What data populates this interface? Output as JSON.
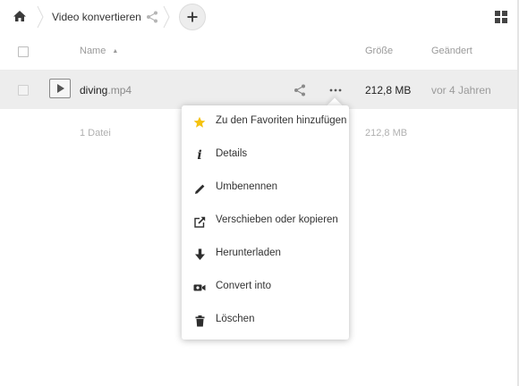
{
  "breadcrumb": {
    "home_icon": "home-icon",
    "current_folder": "Video konvertieren",
    "share_icon": "share-icon",
    "add_icon": "plus-icon",
    "add_label": "+"
  },
  "view_toggle_icon": "grid-view-icon",
  "table": {
    "headers": {
      "name": "Name",
      "size": "Größe",
      "modified": "Geändert"
    },
    "sort": {
      "column": "name",
      "direction": "ascending"
    }
  },
  "file": {
    "base": "diving",
    "ext": ".mp4",
    "type_icon": "video-file-icon",
    "size": "212,8 MB",
    "modified": "vor 4 Jahren"
  },
  "summary": {
    "count": "1 Datei",
    "size": "212,8 MB"
  },
  "menu": {
    "items": [
      {
        "label": "Zu den Favoriten hinzufügen",
        "icon": "star-icon"
      },
      {
        "label": "Details",
        "icon": "info-icon",
        "glyph": "i"
      },
      {
        "label": "Umbenennen",
        "icon": "pencil-icon"
      },
      {
        "label": "Verschieben oder kopieren",
        "icon": "external-move-icon"
      },
      {
        "label": "Herunterladen",
        "icon": "download-icon"
      },
      {
        "label": "Convert into",
        "icon": "video-camera-icon"
      },
      {
        "label": "Löschen",
        "icon": "trash-icon"
      }
    ]
  },
  "colors": {
    "star": "#f5c20f",
    "icon": "#2e2e2e",
    "row_highlight": "#ededed",
    "muted_text": "#9a9a9a"
  }
}
